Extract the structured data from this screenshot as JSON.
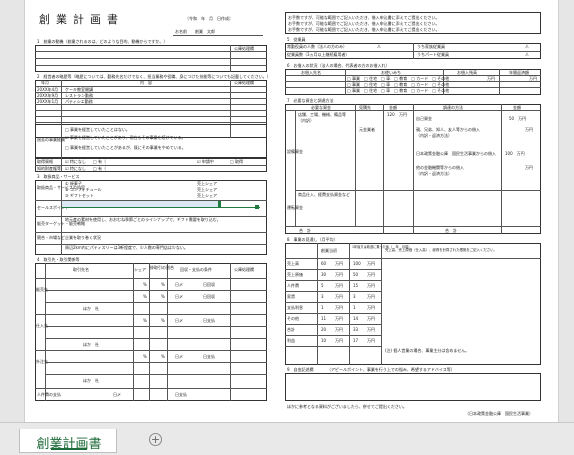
{
  "document": {
    "title": "創業計画書",
    "date": "〔令和　年　月　日作成〕",
    "name_label": "お名前",
    "name_value": "創業　太郎",
    "sec1": "1　創業の動機（創業されるのは、どのような目的、動機からですか。）",
    "sec2": "2　経営者の略歴等（略歴については、勤務先名だけでなく、担当業務や役職、身につけた技能等についても記載してください。）",
    "sec2_col_month": "年月",
    "sec2_col_content": "内　容",
    "sec2_col_note": "公庫処理欄",
    "sec2_rows": [
      {
        "year": "20XX年4月",
        "text": "ケーキ教室開講"
      },
      {
        "year": "20XX年9月",
        "text": "レストラン勤務"
      },
      {
        "year": "20XX年1月",
        "text": "パティシエ勤務"
      }
    ],
    "past_exp_label": "過去の事業経験",
    "past_exp_opts": [
      "□ 事業を経営していたことはない。",
      "☑ 事業を経営していたことがあり、現在もその事業を続けている。",
      "□ 事業を経営していたことがあるが、既にその事業をやめている。"
    ],
    "license_label": "取得資格",
    "license_opts": [
      "☑ 特になし",
      "□ 有（",
      "☑ 申請中",
      "□ 取得"
    ],
    "ip_label": "知的財産権等",
    "ip_opts": [
      "☑ 特になし",
      "□ 有（"
    ],
    "sec3": "3　取扱商品・サービス",
    "product_label": "取扱商品・サービスの内容",
    "products": [
      "① 焼菓子",
      "② コンフィチュール",
      "③ ギフトセット"
    ],
    "share_label": "売上シェア",
    "sales_point_label": "セールスポイント",
    "sales_point_text": "地元産の素材を使用し、おおむね季節ごとのラインナップで、ギフト需要を取り込む。",
    "sales_target_label": "販売ターゲット・販売戦略",
    "competition_label": "競合・市場など企業を取り巻く状況",
    "competition_text": "周辺2km内にパティスリーは3軒程度で、少人数の専門店は少ない。",
    "sec4": "4　取引先・取引関係等",
    "sec4_cols": [
      "取引先名",
      "シェア",
      "掛取引の割合",
      "回収・支払の条件",
      "公庫処理欄"
    ],
    "sec4_groups": [
      "販売先",
      "仕入先",
      "外注先"
    ],
    "sec4_terms": [
      "日〆",
      "日回収",
      "日〆",
      "日支払"
    ],
    "sec4_pct": "%",
    "sec4_other": "ほか　社",
    "sec4_wage": "人件費の支払",
    "sec5": "5　従業員",
    "emp_regular": "常勤役員の人数（法人の方のみ）",
    "emp_staff": "従業員数（3ヵ月以上継続雇用者）",
    "emp_family": "うち家族従業員",
    "emp_part": "うちパート従業員",
    "emp_count": "人",
    "sec6": "6　お借入の状況（法人の場合、代表者の方のお借入れ）",
    "loan_cols": [
      "お借入先名",
      "お使いみち",
      "お借入残高",
      "年間返済額"
    ],
    "loan_uses": "□ 事業　□ 住宅　□ 車　□ 教育　□ カード　□ その他",
    "loan_unit": "万円",
    "sec7": "7　必要な資金と調達方法",
    "fund_cols": [
      "必要な資金",
      "見積先",
      "金額",
      "調達の方法",
      "金額"
    ],
    "fund_equipment": "設備資金",
    "fund_operating": "運転資金",
    "fund_items": [
      "店舗、工場、機械、備品等",
      "（内訳）"
    ],
    "fund_amounts": [
      "120",
      "万円"
    ],
    "fund_quote": "元金業者",
    "fund_sources": [
      "自己資金",
      "親、兄弟、知人、友人等からの借入",
      "（内訳・返済方法）",
      "日本政策金融公庫　国民生活事業からの借入",
      "他の金融機関等からの借入",
      "（内訳・返済方法）"
    ],
    "fund_source_amounts": [
      "50　万円",
      "万円",
      "100　万円",
      "万円"
    ],
    "fund_working": "商品仕入、経費支払資金など",
    "fund_total": "合　計",
    "sec8": "8　事業の見通し（月平均）",
    "forecast_cols": [
      "創業当初",
      "1年後又は軌道に乗った後（　年　月頃）",
      "売上高、売上原価（仕入高）、経費を計算された根拠をご記入ください。"
    ],
    "forecast_rows": [
      {
        "label": "売上高",
        "a": "60",
        "b": "100"
      },
      {
        "label": "売上原価",
        "a": "30",
        "b": "50"
      },
      {
        "label": "人件費",
        "a": "5",
        "b": "15"
      },
      {
        "label": "家賃",
        "a": "3",
        "b": "3"
      },
      {
        "label": "支払利息",
        "a": "1",
        "b": "1"
      },
      {
        "label": "その他",
        "a": "11",
        "b": "14"
      },
      {
        "label": "合計",
        "a": "20",
        "b": "33"
      },
      {
        "label": "利益",
        "a": "10",
        "b": "17"
      }
    ],
    "forecast_unit": "万円",
    "forecast_note": "(注) 個人営業の場合、事業主分は含めません。",
    "sec9": "9　自由記述欄",
    "sec9_hint": "（アピールポイント、事業を行う上での悩み、希望するアドバイス等）",
    "footer_note": "ほかに参考となる資料がございましたら、併せてご提出ください。",
    "footer_source": "（日本政策金融公庫　国民生活事業）",
    "header_note": "お手数ですが、可能な範囲でご記入いただき、借入申込書に添えてご提出ください。"
  },
  "sheet_tabs": [
    {
      "label": "創業計画書",
      "active": true
    }
  ],
  "add_sheet_symbol": "+",
  "colors": {
    "accent": "#1e6b3a",
    "highlight": "#dbe7f3",
    "green_cell": "#1f7a3f"
  }
}
